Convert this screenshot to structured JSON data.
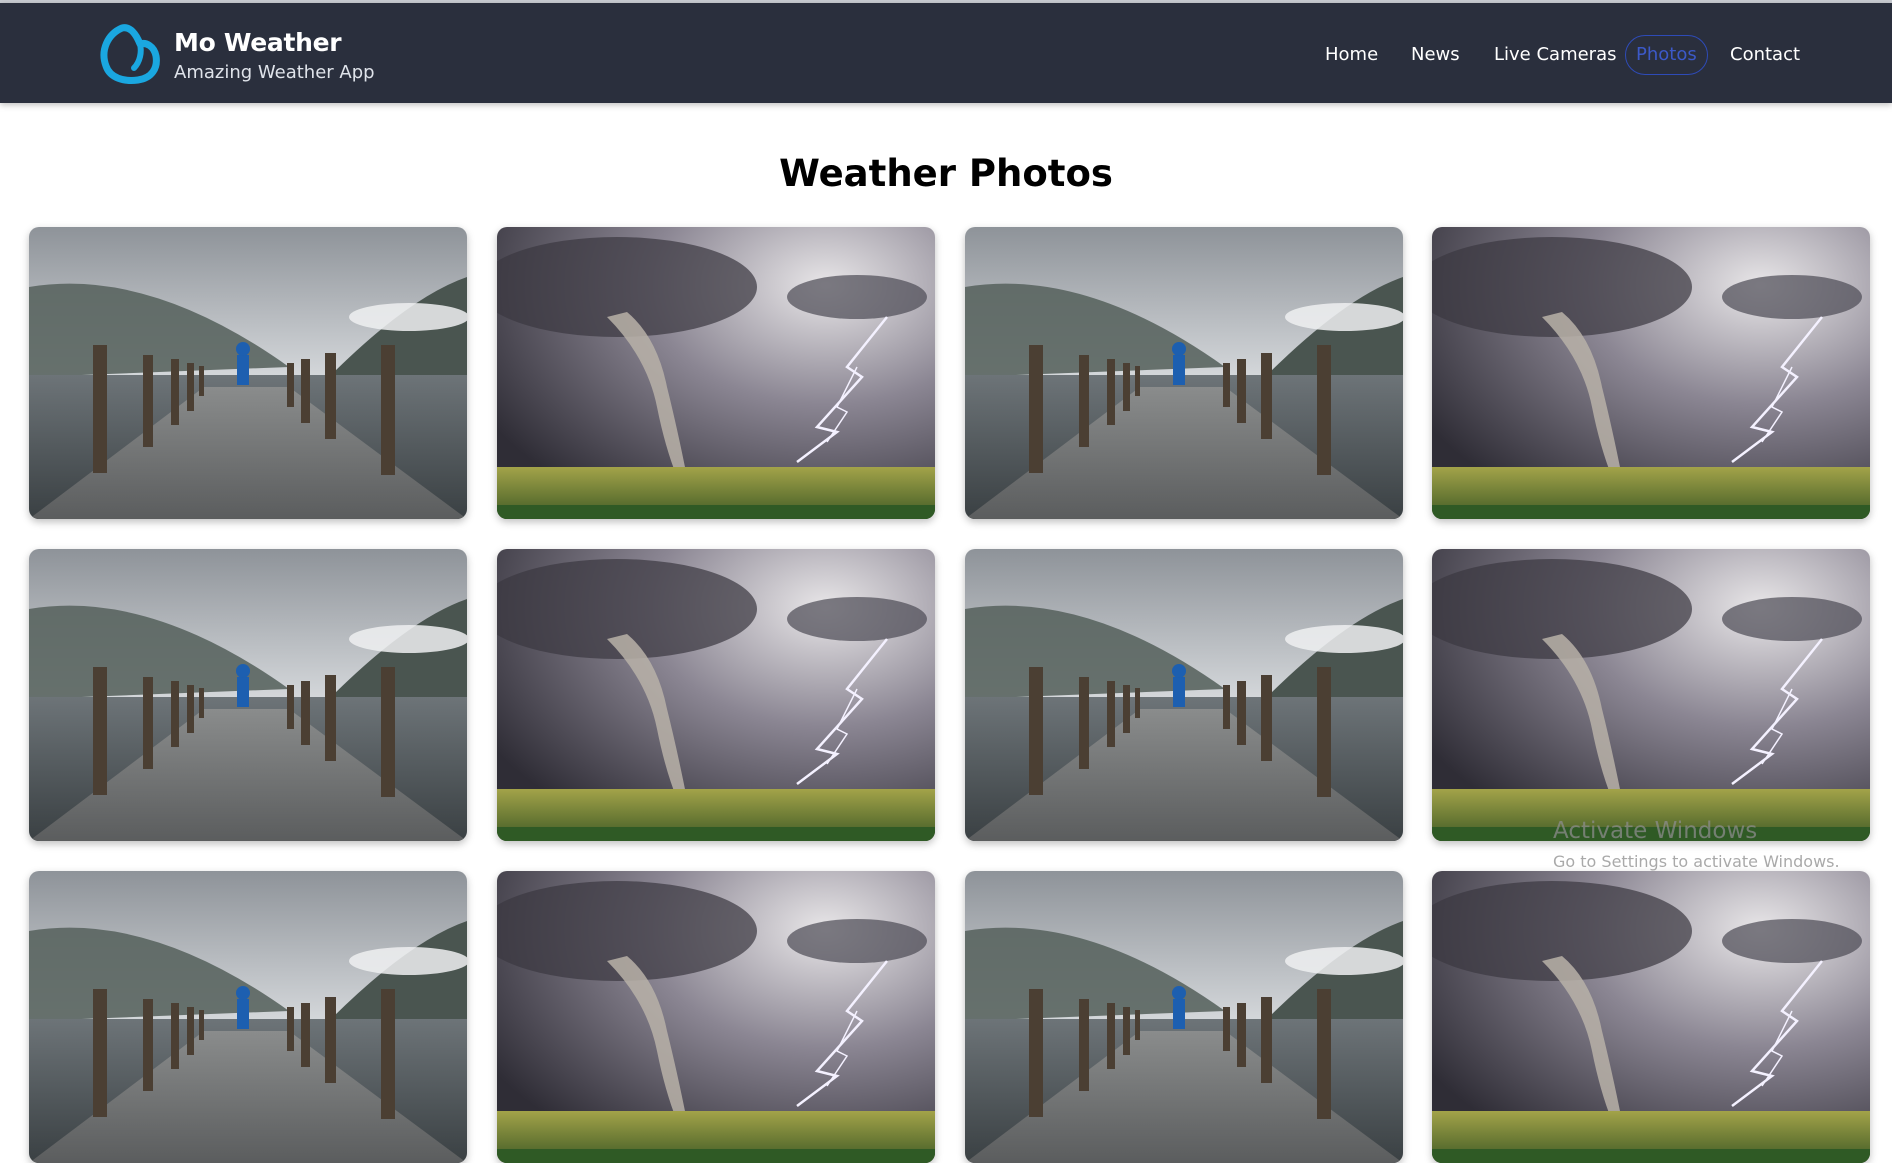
{
  "brand": {
    "title": "Mo Weather",
    "subtitle": "Amazing Weather App",
    "logo_icon": "cloud-heart-icon",
    "logo_color": "#1aa7e0"
  },
  "nav": {
    "items": [
      {
        "label": "Home",
        "active": false
      },
      {
        "label": "News",
        "active": false
      },
      {
        "label": "Live Cameras",
        "active": false
      },
      {
        "label": "Photos",
        "active": true
      },
      {
        "label": "Contact",
        "active": false
      }
    ],
    "active_color": "#3c59c8"
  },
  "page": {
    "title": "Weather Photos"
  },
  "gallery": {
    "photos": [
      {
        "subject": "rainy-pier-lake-photo"
      },
      {
        "subject": "tornado-lightning-photo"
      },
      {
        "subject": "rainy-pier-lake-photo"
      },
      {
        "subject": "tornado-lightning-photo"
      },
      {
        "subject": "rainy-pier-lake-photo"
      },
      {
        "subject": "tornado-lightning-photo"
      },
      {
        "subject": "rainy-pier-lake-photo"
      },
      {
        "subject": "tornado-lightning-photo"
      },
      {
        "subject": "rainy-pier-lake-photo"
      },
      {
        "subject": "tornado-lightning-photo"
      },
      {
        "subject": "rainy-pier-lake-photo"
      },
      {
        "subject": "tornado-lightning-photo"
      }
    ]
  },
  "watermark": {
    "title": "Activate Windows",
    "subtitle": "Go to Settings to activate Windows."
  },
  "colors": {
    "navbar_bg": "#2a2f3d",
    "page_bg": "#ffffff"
  }
}
